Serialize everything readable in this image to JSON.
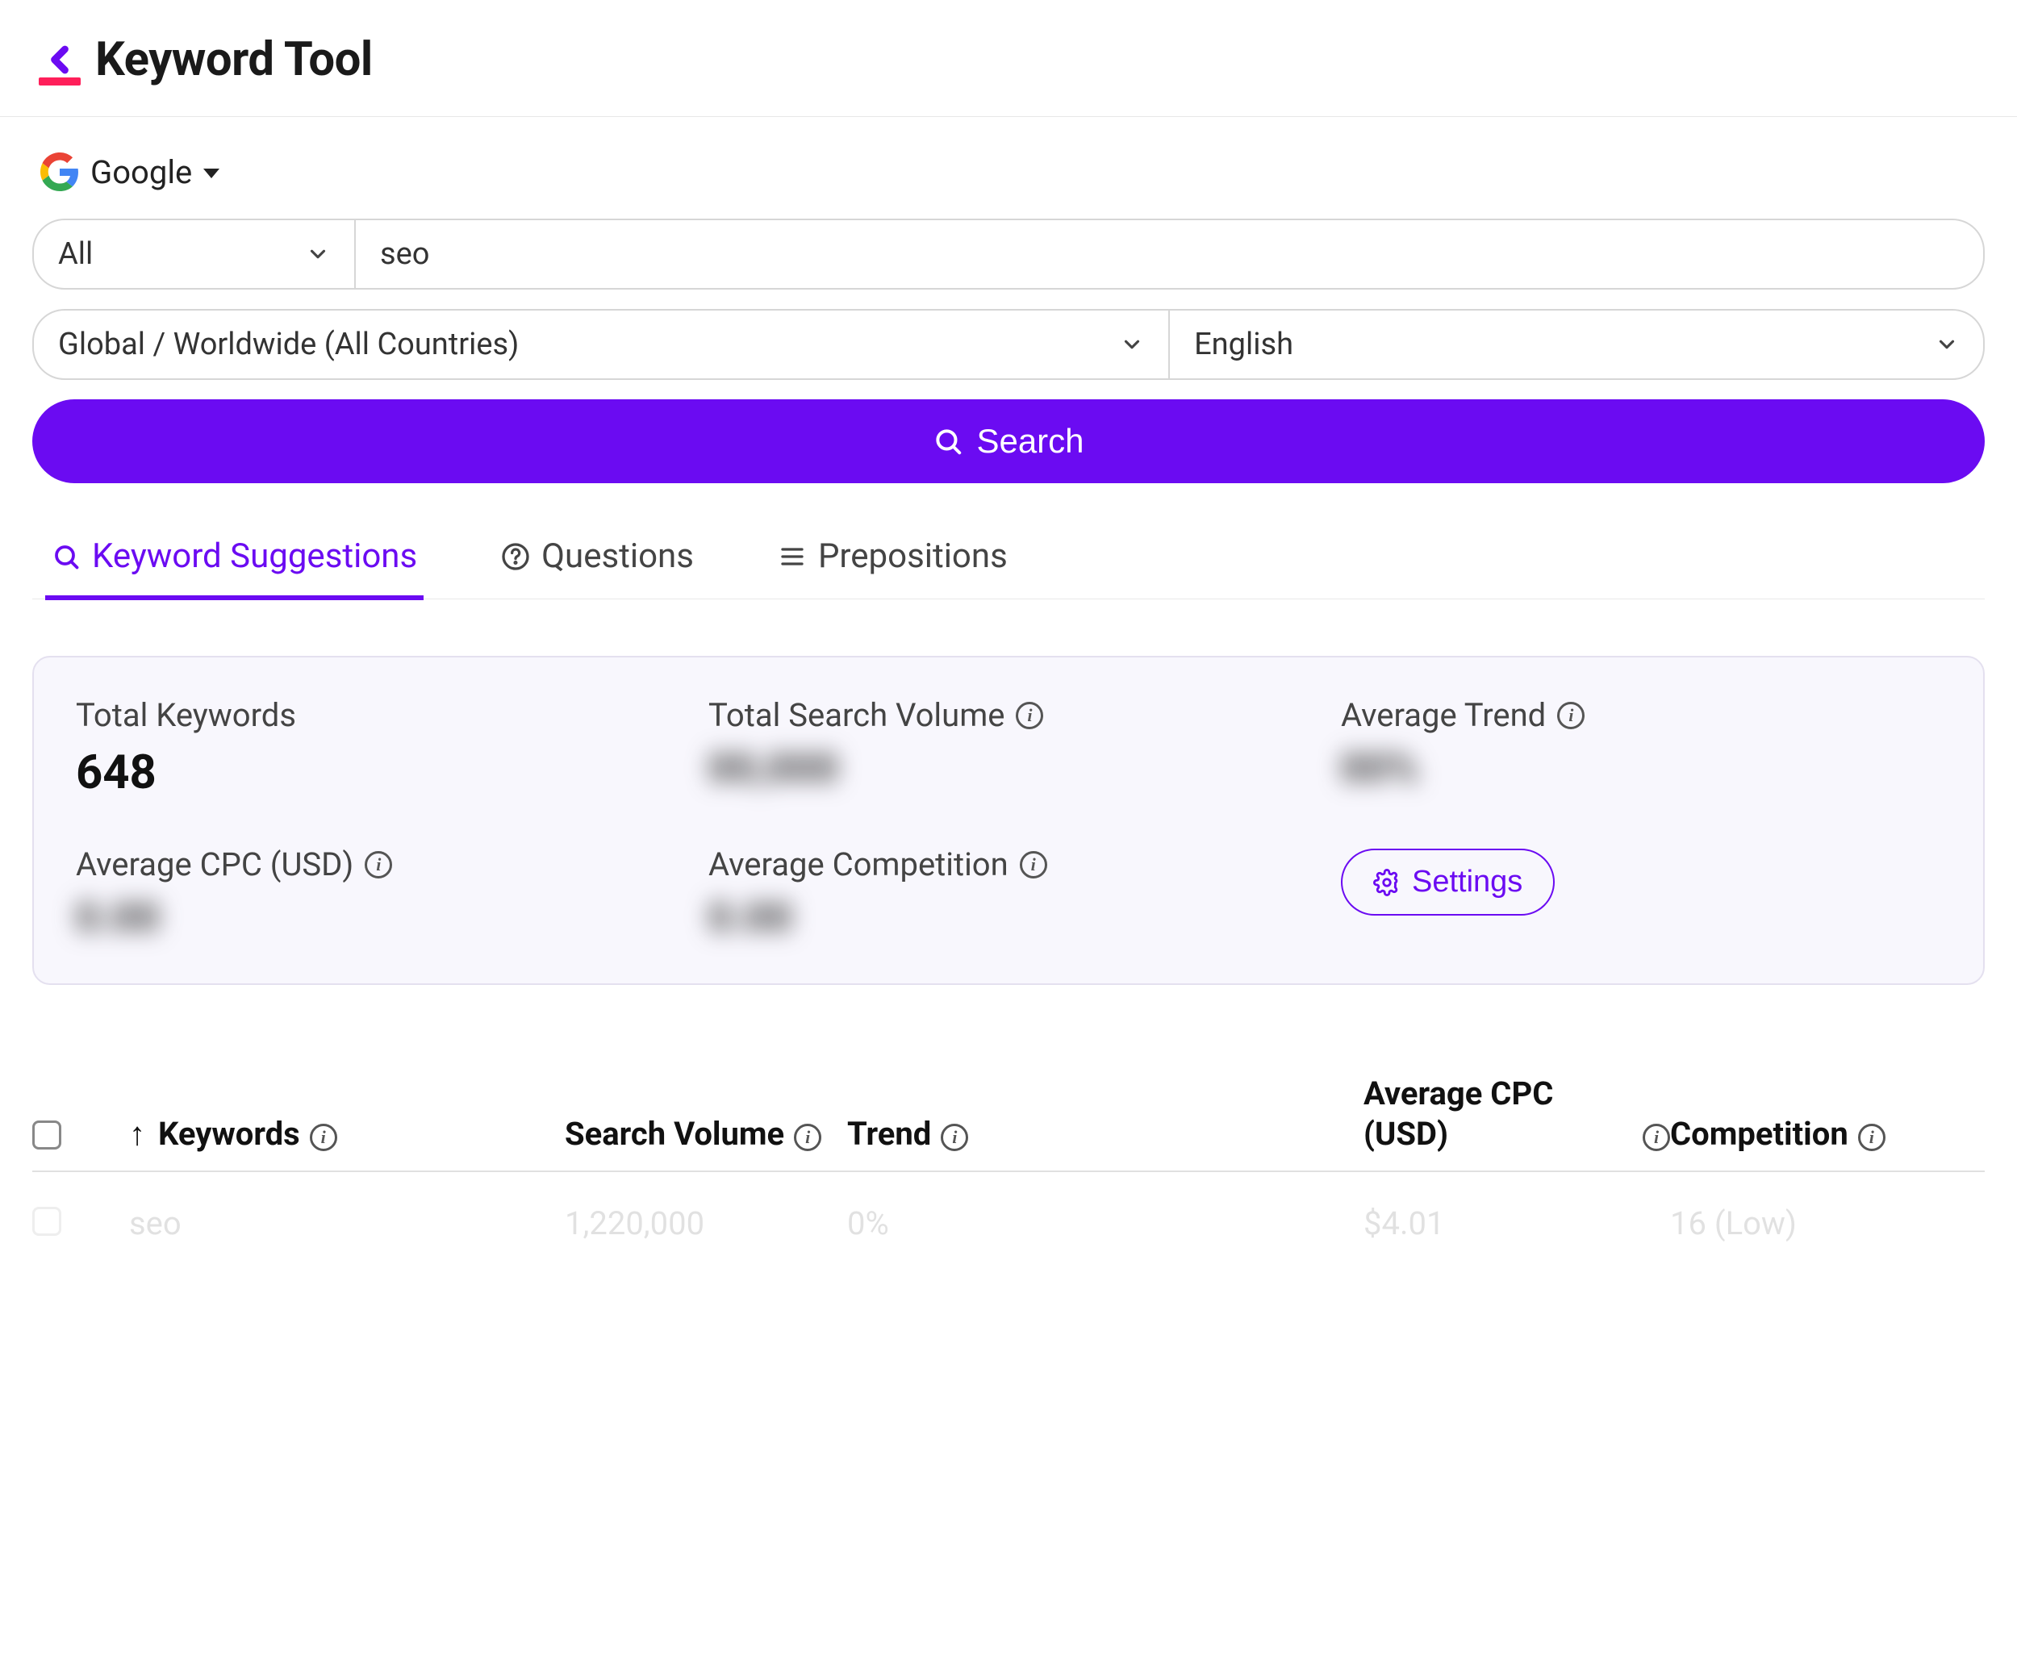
{
  "header": {
    "title": "Keyword Tool"
  },
  "source": {
    "label": "Google"
  },
  "filters": {
    "category": "All",
    "query": "seo",
    "location": "Global / Worldwide (All Countries)",
    "language": "English"
  },
  "search_button": "Search",
  "tabs": {
    "active": "Keyword Suggestions",
    "questions": "Questions",
    "prepositions": "Prepositions"
  },
  "stats": {
    "total_keywords_label": "Total Keywords",
    "total_keywords_value": "648",
    "total_search_volume_label": "Total Search Volume",
    "total_search_volume_value": "00,000",
    "average_trend_label": "Average Trend",
    "average_trend_value": "00%",
    "average_cpc_label": "Average CPC (USD)",
    "average_cpc_value": "0.00",
    "average_competition_label": "Average Competition",
    "average_competition_value": "0.00",
    "settings_label": "Settings"
  },
  "table": {
    "columns": {
      "keywords": "Keywords",
      "search_volume": "Search Volume",
      "trend": "Trend",
      "avg_cpc": "Average CPC (USD)",
      "competition": "Competition"
    },
    "rows": [
      {
        "keyword": "seo",
        "search_volume": "1,220,000",
        "trend": "0%",
        "avg_cpc": "$4.01",
        "competition": "16 (Low)"
      }
    ]
  }
}
